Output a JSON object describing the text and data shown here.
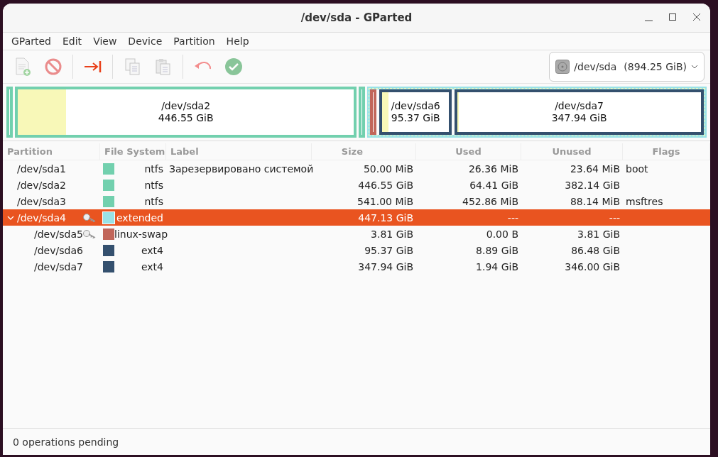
{
  "window": {
    "title": "/dev/sda - GParted"
  },
  "menu": [
    "GParted",
    "Edit",
    "View",
    "Device",
    "Partition",
    "Help"
  ],
  "toolbar": [
    {
      "kind": "new",
      "disabled": true
    },
    {
      "kind": "delete",
      "disabled": true
    },
    {
      "kind": "sep"
    },
    {
      "kind": "resize",
      "disabled": false
    },
    {
      "kind": "sep"
    },
    {
      "kind": "copy",
      "disabled": true
    },
    {
      "kind": "paste",
      "disabled": true
    },
    {
      "kind": "sep"
    },
    {
      "kind": "undo",
      "disabled": true
    },
    {
      "kind": "apply",
      "disabled": true
    }
  ],
  "device": {
    "name": "/dev/sda",
    "size": "(894.25 GiB)"
  },
  "disk_map": [
    {
      "kind": "sliver",
      "color": "#72d0ae"
    },
    {
      "kind": "block",
      "color": "#72d0ae",
      "name": "/dev/sda2",
      "size": "446.55 GiB",
      "level": 0.144
    },
    {
      "kind": "sliver",
      "color": "#72d0ae"
    },
    {
      "kind": "extended",
      "color": "#99e2e6",
      "children": [
        {
          "kind": "sliver",
          "color": "#c1665a"
        },
        {
          "kind": "block",
          "color": "#34506e",
          "name": "/dev/sda6",
          "size": "95.37 GiB",
          "level": 0.093
        },
        {
          "kind": "block",
          "color": "#34506e",
          "name": "/dev/sda7",
          "size": "347.94 GiB",
          "level": 0.006
        }
      ]
    }
  ],
  "table": {
    "columns": [
      "Partition",
      "File System",
      "Label",
      "Size",
      "Used",
      "Unused",
      "Flags"
    ],
    "rows": [
      {
        "partition": "/dev/sda1",
        "locked": false,
        "color": "#72d0ae",
        "fs": "ntfs",
        "label": "Зарезервировано системой",
        "size": "50.00 MiB",
        "used": "26.36 MiB",
        "unused": "23.64 MiB",
        "flags": "boot",
        "selected": false
      },
      {
        "partition": "/dev/sda2",
        "locked": false,
        "color": "#72d0ae",
        "fs": "ntfs",
        "size": "446.55 GiB",
        "used": "64.41 GiB",
        "unused": "382.14 GiB",
        "selected": false
      },
      {
        "partition": "/dev/sda3",
        "locked": false,
        "color": "#72d0ae",
        "fs": "ntfs",
        "size": "541.00 MiB",
        "used": "452.86 MiB",
        "unused": "88.14 MiB",
        "flags": "msftres",
        "selected": false
      },
      {
        "partition": "/dev/sda4",
        "locked": true,
        "color": "#99e2e6",
        "fs": "extended",
        "size": "447.13 GiB",
        "used": "---",
        "unused": "---",
        "selected": true,
        "expanded": true,
        "children": [
          {
            "partition": "/dev/sda5",
            "locked": true,
            "color": "#c1665a",
            "fs": "linux-swap",
            "size": "3.81 GiB",
            "used": "0.00 B",
            "unused": "3.81 GiB",
            "selected": false
          },
          {
            "partition": "/dev/sda6",
            "locked": false,
            "color": "#34506e",
            "fs": "ext4",
            "size": "95.37 GiB",
            "used": "8.89 GiB",
            "unused": "86.48 GiB",
            "selected": false
          },
          {
            "partition": "/dev/sda7",
            "locked": false,
            "color": "#34506e",
            "fs": "ext4",
            "size": "347.94 GiB",
            "used": "1.94 GiB",
            "unused": "346.00 GiB",
            "selected": false
          }
        ]
      }
    ]
  },
  "status_bar": "0 operations pending"
}
